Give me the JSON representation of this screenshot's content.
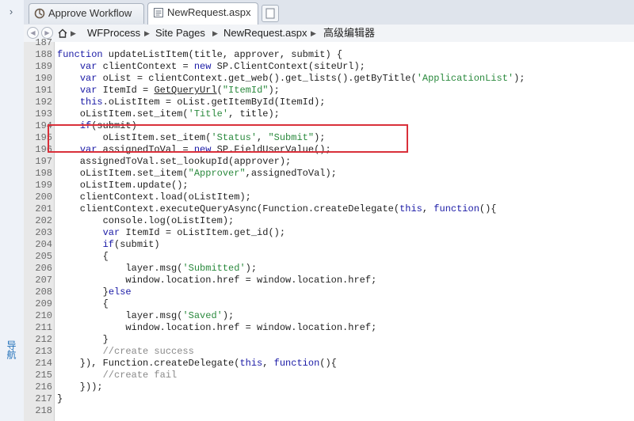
{
  "nav": {
    "label": "导航"
  },
  "tabs": [
    {
      "label": "Approve Workflow",
      "icon": "workflow-icon"
    },
    {
      "label": "NewRequest.aspx",
      "icon": "file-icon",
      "active": true
    }
  ],
  "breadcrumb": [
    "WFProcess",
    "Site Pages",
    "NewRequest.aspx",
    "高级编辑器"
  ],
  "highlight_color": "#d9303a",
  "code_lines": [
    {
      "n": "187",
      "code": ""
    },
    {
      "n": "188",
      "code": "function updateListItem(title, approver, submit) {"
    },
    {
      "n": "189",
      "code": "    var clientContext = new SP.ClientContext(siteUrl);"
    },
    {
      "n": "190",
      "code": "    var oList = clientContext.get_web().get_lists().getByTitle('ApplicationList');"
    },
    {
      "n": "191",
      "code": "    var ItemId = GetQueryUrl(\"ItemId\");"
    },
    {
      "n": "192",
      "code": "    this.oListItem = oList.getItemById(ItemId);"
    },
    {
      "n": "193",
      "code": "    oListItem.set_item('Title', title);"
    },
    {
      "n": "194",
      "code": "    if(submit)"
    },
    {
      "n": "195",
      "code": "        oListItem.set_item('Status', \"Submit\");"
    },
    {
      "n": "196",
      "code": "    var assignedToVal = new SP.FieldUserValue();"
    },
    {
      "n": "197",
      "code": "    assignedToVal.set_lookupId(approver);"
    },
    {
      "n": "198",
      "code": "    oListItem.set_item(\"Approver\",assignedToVal);"
    },
    {
      "n": "199",
      "code": "    oListItem.update();"
    },
    {
      "n": "200",
      "code": "    clientContext.load(oListItem);"
    },
    {
      "n": "201",
      "code": "    clientContext.executeQueryAsync(Function.createDelegate(this, function(){"
    },
    {
      "n": "202",
      "code": "        console.log(oListItem);"
    },
    {
      "n": "203",
      "code": "        var ItemId = oListItem.get_id();"
    },
    {
      "n": "204",
      "code": "        if(submit)"
    },
    {
      "n": "205",
      "code": "        {"
    },
    {
      "n": "206",
      "code": "            layer.msg('Submitted');"
    },
    {
      "n": "207",
      "code": "            window.location.href = window.location.href;"
    },
    {
      "n": "208",
      "code": "        }else"
    },
    {
      "n": "209",
      "code": "        {"
    },
    {
      "n": "210",
      "code": "            layer.msg('Saved');"
    },
    {
      "n": "211",
      "code": "            window.location.href = window.location.href;"
    },
    {
      "n": "212",
      "code": "        }"
    },
    {
      "n": "213",
      "code": "        //create success"
    },
    {
      "n": "214",
      "code": "    }), Function.createDelegate(this, function(){"
    },
    {
      "n": "215",
      "code": "        //create fail"
    },
    {
      "n": "216",
      "code": "    }));"
    },
    {
      "n": "217",
      "code": "}"
    },
    {
      "n": "218",
      "code": ""
    }
  ]
}
